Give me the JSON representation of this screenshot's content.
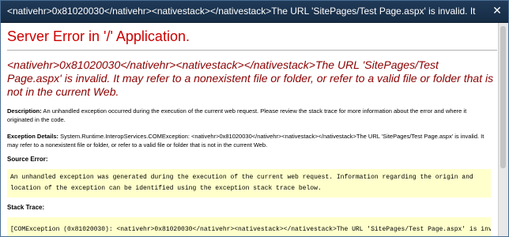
{
  "window": {
    "title": "<nativehr>0x81020030</nativehr><nativestack></nativestack>The URL 'SitePages/Test Page.aspx' is invalid.  It may refer t...",
    "close_glyph": "✕"
  },
  "error": {
    "heading": "Server Error in '/' Application.",
    "message": "<nativehr>0x81020030</nativehr><nativestack></nativestack>The URL 'SitePages/Test Page.aspx' is invalid.  It may refer to a nonexistent file or folder, or refer to a valid file or folder that is not in the current Web.",
    "description_label": "Description:",
    "description_text": " An unhandled exception occurred during the execution of the current web request. Please review the stack trace for more information about the error and where it originated in the code.",
    "exception_label": "Exception Details:",
    "exception_text": " System.Runtime.InteropServices.COMException: <nativehr>0x81020030</nativehr><nativestack></nativestack>The URL 'SitePages/Test Page.aspx' is invalid.  It may refer to a nonexistent file or folder, or refer to a valid file or folder that is not in the current Web.",
    "source_error_label": "Source Error:",
    "source_error_text": "An unhandled exception was generated during the execution of the current web request. Information regarding the origin and location of the exception can be identified using the exception stack trace below.",
    "stack_trace_label": "Stack Trace:",
    "stack_trace_text": "[COMException (0x81020030): <nativehr>0x81020030</nativehr><nativestack></nativestack>The URL 'SitePages/Test Page.aspx' is invalid."
  },
  "colors": {
    "heading": "#cc0000",
    "message": "#8b0000",
    "code_background": "#ffffcc",
    "titlebar": "#1b3350"
  }
}
